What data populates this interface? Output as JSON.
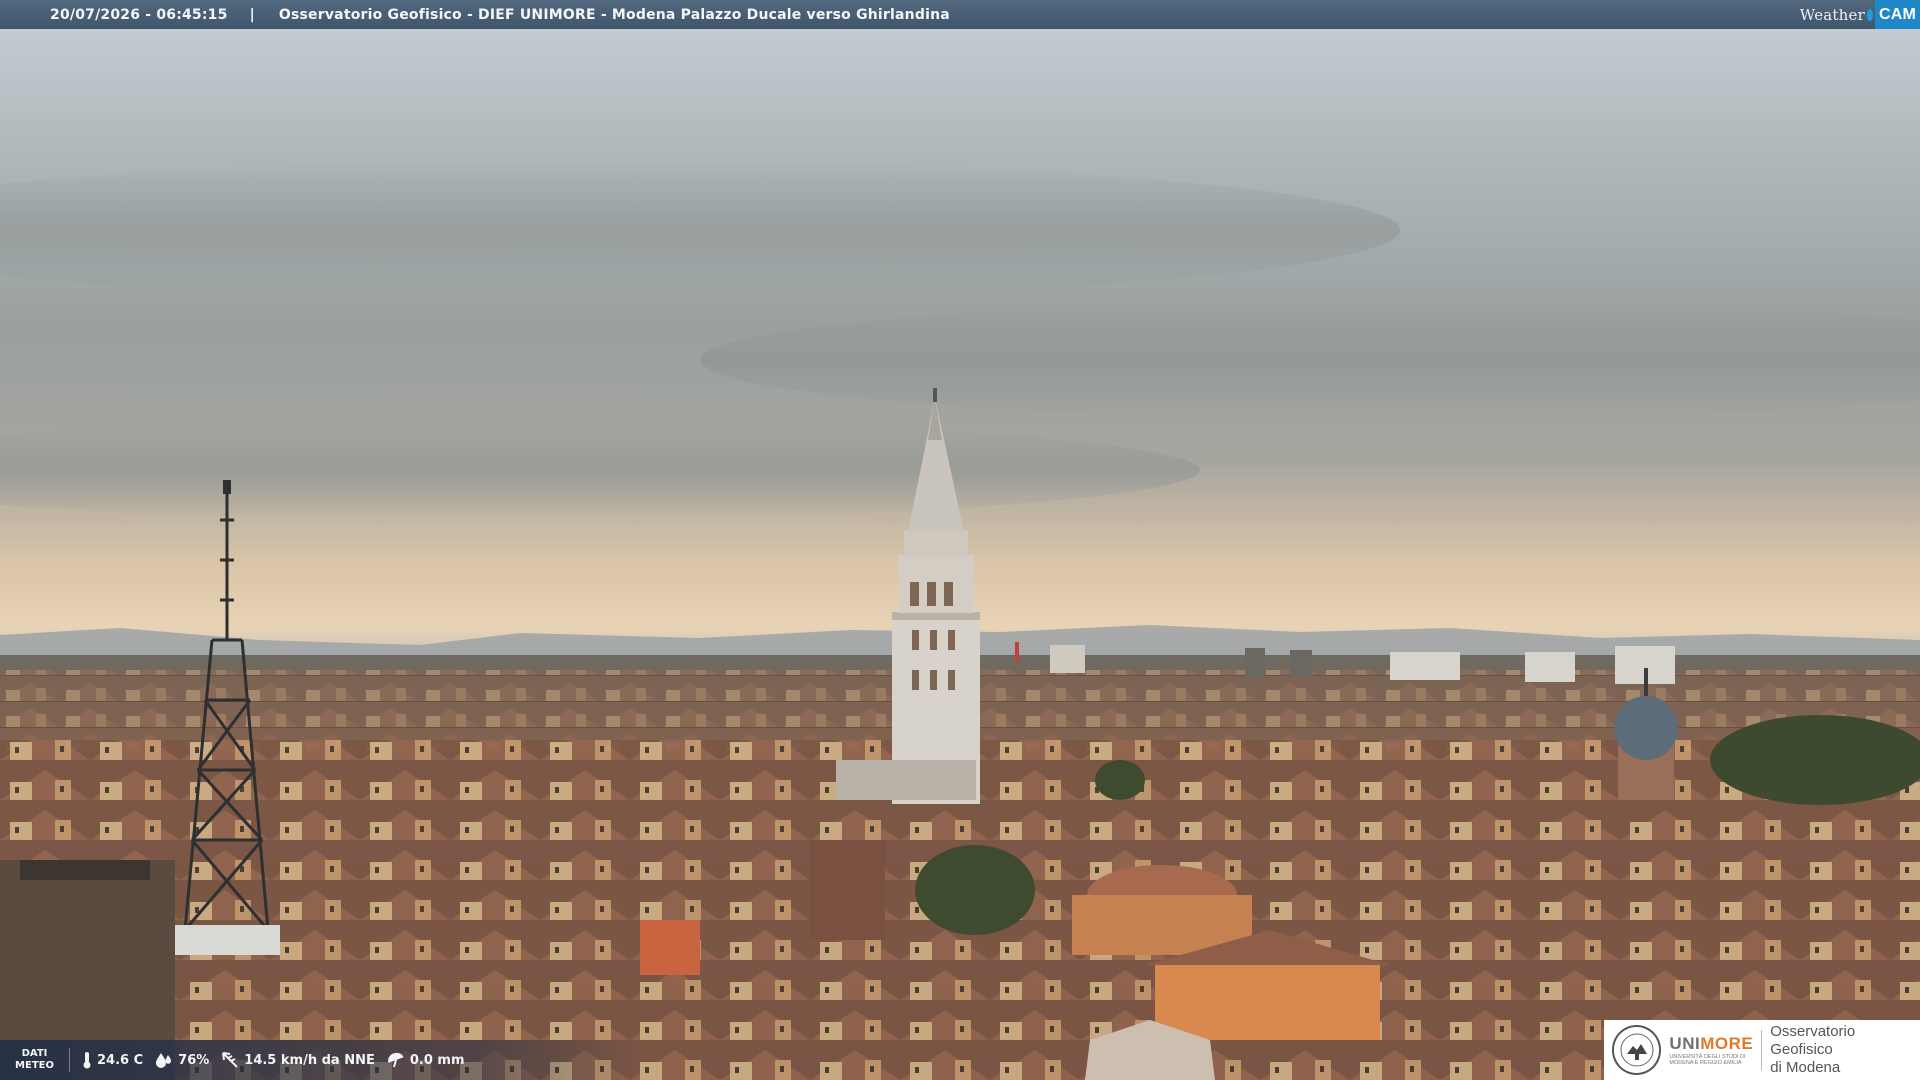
{
  "overlay": {
    "timestamp": "20/07/2026 - 06:45:15",
    "separator": "|",
    "camera_title": "Osservatorio Geofisico - DIEF UNIMORE - Modena Palazzo Ducale verso Ghirlandina",
    "brand_weather": "Weather",
    "brand_cam": "CAM"
  },
  "meteo": {
    "label_line1": "DATI",
    "label_line2": "METEO",
    "temperature": "24.6 C",
    "humidity": "76%",
    "wind": "14.5 km/h da NNE",
    "rain": "0.0 mm"
  },
  "logo": {
    "uni_part1": "UNI",
    "uni_part2": "MORE",
    "uni_sub1": "UNIVERSITÀ DEGLI STUDI DI",
    "uni_sub2": "MODENA E REGGIO EMILIA",
    "observatory_line1": "Osservatorio Geofisico",
    "observatory_line2": "di Modena"
  },
  "colors": {
    "sky_top": "#c9d1d6",
    "sky_mid": "#9aa09e",
    "horizon_glow": "#e6c9a4",
    "roof": "#8a5a45",
    "tower_stone": "#d9d4cc"
  }
}
